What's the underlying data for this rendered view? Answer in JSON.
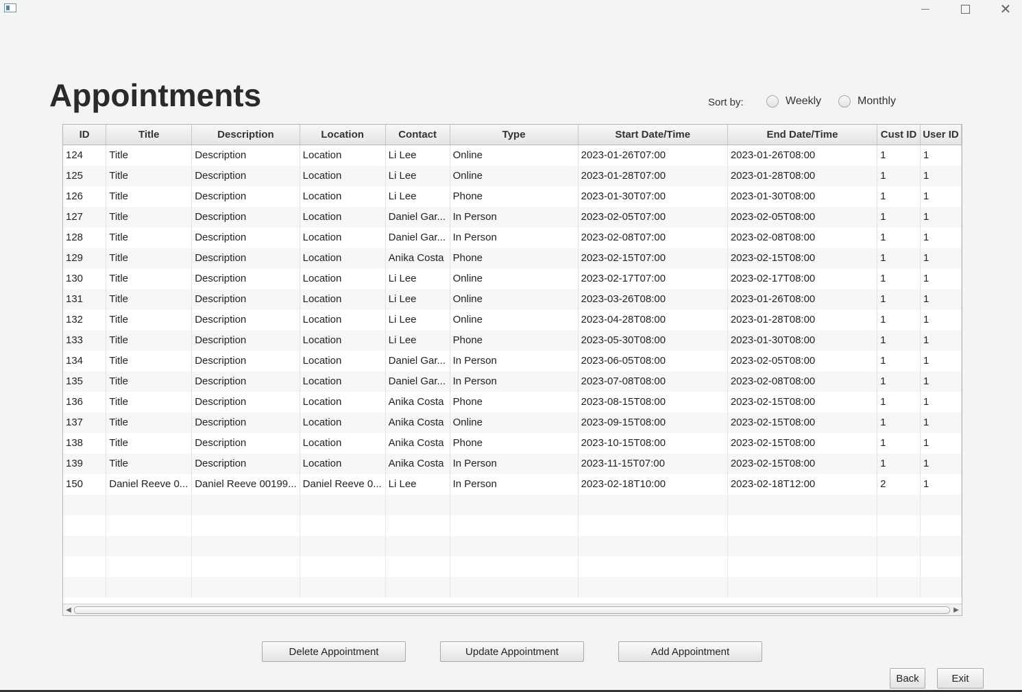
{
  "window": {
    "icons": {
      "app": "java-app-icon",
      "minimize": "minimize-icon",
      "maximize": "maximize-icon",
      "close": "close-icon"
    }
  },
  "page": {
    "title": "Appointments"
  },
  "sort": {
    "label": "Sort by:",
    "options": [
      {
        "label": "Weekly",
        "selected": false
      },
      {
        "label": "Monthly",
        "selected": false
      }
    ]
  },
  "table": {
    "columns": [
      "ID",
      "Title",
      "Description",
      "Location",
      "Contact",
      "Type",
      "Start Date/Time",
      "End Date/Time",
      "Cust ID",
      "User ID"
    ],
    "rows": [
      [
        "124",
        "Title",
        "Description",
        "Location",
        "Li Lee",
        "Online",
        "2023-01-26T07:00",
        "2023-01-26T08:00",
        "1",
        "1"
      ],
      [
        "125",
        "Title",
        "Description",
        "Location",
        "Li Lee",
        "Online",
        "2023-01-28T07:00",
        "2023-01-28T08:00",
        "1",
        "1"
      ],
      [
        "126",
        "Title",
        "Description",
        "Location",
        "Li Lee",
        "Phone",
        "2023-01-30T07:00",
        "2023-01-30T08:00",
        "1",
        "1"
      ],
      [
        "127",
        "Title",
        "Description",
        "Location",
        "Daniel Gar...",
        "In Person",
        "2023-02-05T07:00",
        "2023-02-05T08:00",
        "1",
        "1"
      ],
      [
        "128",
        "Title",
        "Description",
        "Location",
        "Daniel Gar...",
        "In Person",
        "2023-02-08T07:00",
        "2023-02-08T08:00",
        "1",
        "1"
      ],
      [
        "129",
        "Title",
        "Description",
        "Location",
        "Anika Costa",
        "Phone",
        "2023-02-15T07:00",
        "2023-02-15T08:00",
        "1",
        "1"
      ],
      [
        "130",
        "Title",
        "Description",
        "Location",
        "Li Lee",
        "Online",
        "2023-02-17T07:00",
        "2023-02-17T08:00",
        "1",
        "1"
      ],
      [
        "131",
        "Title",
        "Description",
        "Location",
        "Li Lee",
        "Online",
        "2023-03-26T08:00",
        "2023-01-26T08:00",
        "1",
        "1"
      ],
      [
        "132",
        "Title",
        "Description",
        "Location",
        "Li Lee",
        "Online",
        "2023-04-28T08:00",
        "2023-01-28T08:00",
        "1",
        "1"
      ],
      [
        "133",
        "Title",
        "Description",
        "Location",
        "Li Lee",
        "Phone",
        "2023-05-30T08:00",
        "2023-01-30T08:00",
        "1",
        "1"
      ],
      [
        "134",
        "Title",
        "Description",
        "Location",
        "Daniel Gar...",
        "In Person",
        "2023-06-05T08:00",
        "2023-02-05T08:00",
        "1",
        "1"
      ],
      [
        "135",
        "Title",
        "Description",
        "Location",
        "Daniel Gar...",
        "In Person",
        "2023-07-08T08:00",
        "2023-02-08T08:00",
        "1",
        "1"
      ],
      [
        "136",
        "Title",
        "Description",
        "Location",
        "Anika Costa",
        "Phone",
        "2023-08-15T08:00",
        "2023-02-15T08:00",
        "1",
        "1"
      ],
      [
        "137",
        "Title",
        "Description",
        "Location",
        "Anika Costa",
        "Online",
        "2023-09-15T08:00",
        "2023-02-15T08:00",
        "1",
        "1"
      ],
      [
        "138",
        "Title",
        "Description",
        "Location",
        "Anika Costa",
        "Phone",
        "2023-10-15T08:00",
        "2023-02-15T08:00",
        "1",
        "1"
      ],
      [
        "139",
        "Title",
        "Description",
        "Location",
        "Anika Costa",
        "In Person",
        "2023-11-15T07:00",
        "2023-02-15T08:00",
        "1",
        "1"
      ],
      [
        "150",
        "Daniel Reeve 0...",
        "Daniel Reeve 00199...",
        "Daniel Reeve 0...",
        "Li Lee",
        "In Person",
        "2023-02-18T10:00",
        "2023-02-18T12:00",
        "2",
        "1"
      ]
    ]
  },
  "buttons": {
    "delete": "Delete Appointment",
    "update": "Update Appointment",
    "add": "Add Appointment",
    "back": "Back",
    "exit": "Exit"
  }
}
